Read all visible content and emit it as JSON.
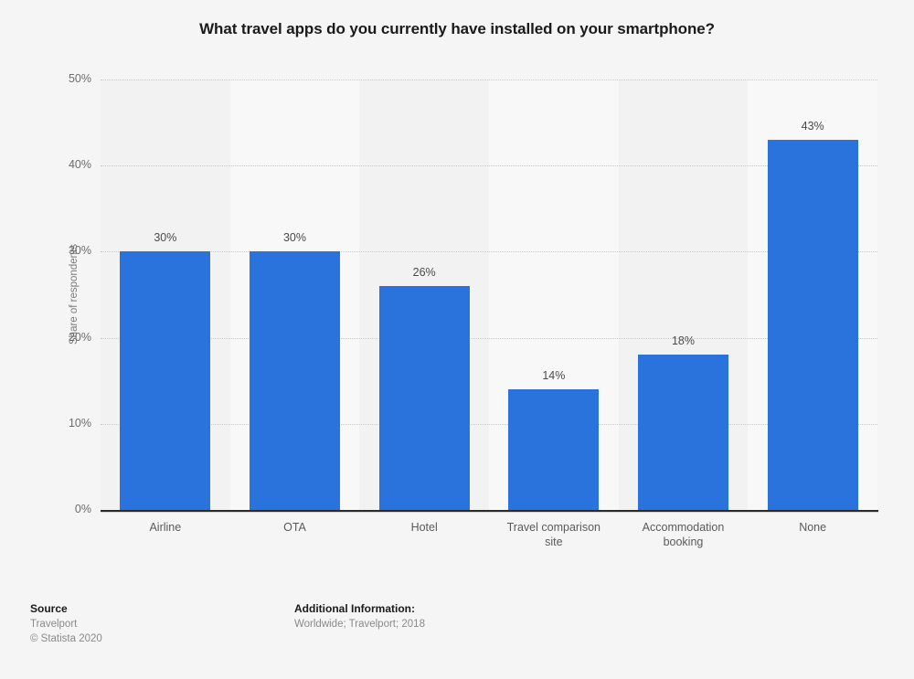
{
  "title": "What travel apps do you currently have installed on your smartphone?",
  "axis": {
    "ylabel": "Share of respondents",
    "yticks": [
      "50%",
      "40%",
      "30%",
      "20%",
      "10%",
      "0%"
    ]
  },
  "footer": {
    "source_heading": "Source",
    "source_name": "Travelport",
    "source_copyright": "© Statista 2020",
    "additional_heading": "Additional Information:",
    "additional_text": "Worldwide; Travelport; 2018"
  },
  "colors": {
    "bar": "#2a72dc",
    "background": "#f5f5f5",
    "band_odd": "#f2f2f2",
    "band_even": "#f8f8f8",
    "gridline": "#c8c8c8",
    "baseline": "#2b2b2b"
  },
  "chart_data": {
    "type": "bar",
    "title": "What travel apps do you currently have installed on your smartphone?",
    "xlabel": "",
    "ylabel": "Share of respondents",
    "ylim": [
      0,
      50
    ],
    "ytick_values": [
      0,
      10,
      20,
      30,
      40,
      50
    ],
    "grid": true,
    "legend": null,
    "categories": [
      "Airline",
      "OTA",
      "Hotel",
      "Travel comparison site",
      "Accommodation booking",
      "None"
    ],
    "category_lines": [
      [
        "Airline"
      ],
      [
        "OTA"
      ],
      [
        "Hotel"
      ],
      [
        "Travel comparison",
        "site"
      ],
      [
        "Accommodation",
        "booking"
      ],
      [
        "None"
      ]
    ],
    "values": [
      30,
      30,
      26,
      14,
      18,
      43
    ],
    "data_labels": [
      "30%",
      "30%",
      "26%",
      "14%",
      "18%",
      "43%"
    ]
  }
}
